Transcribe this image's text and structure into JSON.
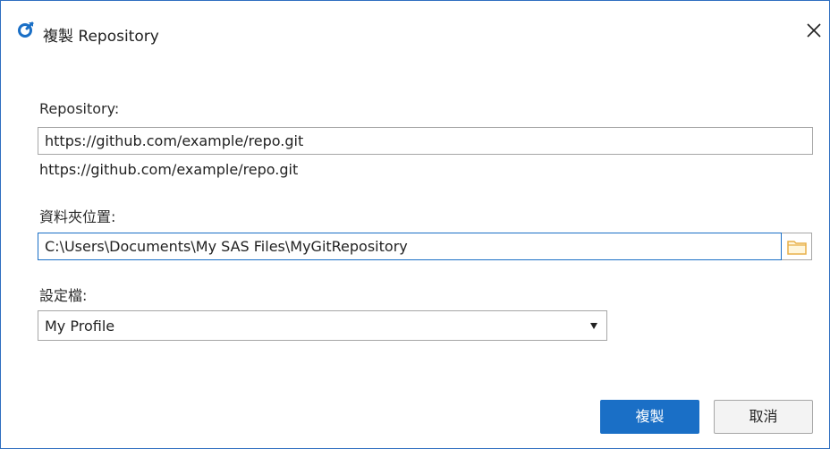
{
  "window": {
    "title": "複製 Repository",
    "icon": "sas-git-icon",
    "close_icon": "close-icon"
  },
  "repository": {
    "label": "Repository:",
    "value": "https://github.com/example/repo.git",
    "echo": "https://github.com/example/repo.git"
  },
  "folder": {
    "label": "資料夾位置:",
    "value": "C:\\Users\\Documents\\My SAS Files\\MyGitRepository",
    "browse_icon": "folder-icon"
  },
  "profile": {
    "label": "設定檔:",
    "selected": "My Profile"
  },
  "buttons": {
    "clone": "複製",
    "cancel": "取消"
  },
  "colors": {
    "accent": "#1a6fc6",
    "border": "#a6a6a6",
    "folder_icon": "#e8b04a"
  }
}
